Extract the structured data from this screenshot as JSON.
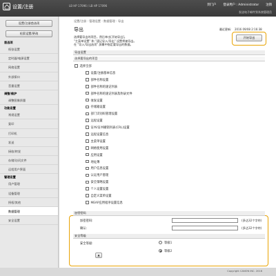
{
  "header": {
    "title": "设置/注册",
    "device": "LB  HP 17096 / LB HP 17096",
    "links": [
      "到门户",
      "登录用户 : Administrator",
      "注销"
    ],
    "sub": "发送电子邮件到系统管理员"
  },
  "sidebar": {
    "top_buttons": [
      "设置/注册首选项",
      "检索设置/更改"
    ],
    "groups": [
      {
        "label": "首选项",
        "items": [
          "纸张设置",
          "定时器/电源设置",
          "网络设置",
          "外部接口",
          "音量设置"
        ]
      },
      {
        "label": "调整/维护",
        "items": [
          "调整图像质量"
        ]
      },
      {
        "label": "功能设置",
        "items": [
          "常规设置",
          "复印",
          "打印机",
          "发送",
          "接收/转发",
          "存储/访问文件",
          "远程用户界面"
        ]
      },
      {
        "label": "管理设置",
        "items": [
          "用户管理",
          "设备管理",
          "授权/其他",
          "数据管理",
          "安全设置"
        ]
      }
    ],
    "active": "数据管理"
  },
  "main": {
    "breadcrumb": "设置/注册 : 管理设置 : 数据管理 : 导出",
    "title": "导出",
    "last_update_label": "最近更新:",
    "last_update_value": "2016 09/08 2:16:38",
    "description": [
      "选择要导出的项目，然后单击[开始导出]。",
      "\"主菜单设置\" 和 \"速记导入/导出\" 设置将被导出。",
      "在 \"导入/导出选项\" 屏幕中指定要导出的数据。"
    ],
    "export_button": "开始导出",
    "section_export": "导出设置",
    "section_items": "选择要导出的项目",
    "select_all": "选择全部",
    "items": [
      "设置/注册基本信息",
      "部件名称设置",
      "部件名称的速记列表",
      "部件名称的速记列表及附录文件",
      "收发设置",
      "存储箱设置",
      "部门识别码管理设置",
      "远程设置",
      "证书/证书撤销列表(CRL)设置",
      "远程设置信息",
      "主菜单设置",
      "网络使用设置",
      "应用设置",
      "地址簿",
      "用户信息设置",
      "认证用户管理",
      "安全策略设置",
      "个人设置设置",
      "自定义菜单设置",
      "MEAP应用程序设置信息"
    ],
    "encryption": {
      "section": "加密密码",
      "password_label": "加密密码:",
      "confirm_label": "确认:",
      "hint": "(多达32个字符)",
      "security_section": "安全等级",
      "level_label": "安全等级:",
      "options": [
        "等级1",
        "等级2"
      ],
      "selected": "等级2"
    },
    "bottom_button": "▲"
  },
  "footer": {
    "copyright": "Copyright CANON INC. 2016"
  }
}
